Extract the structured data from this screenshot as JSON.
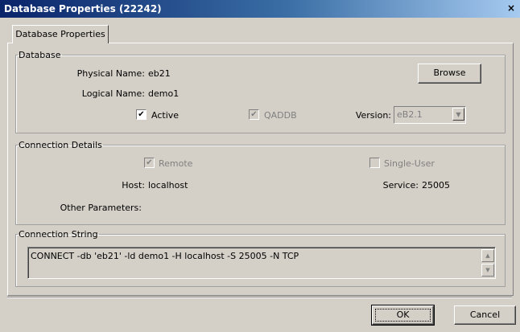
{
  "window": {
    "title": "Database Properties (22242)",
    "close_glyph": "×"
  },
  "tab": {
    "label": "Database Properties"
  },
  "database": {
    "legend": "Database",
    "physical_name_label": "Physical Name:",
    "physical_name_value": "eb21",
    "logical_name_label": "Logical Name:",
    "logical_name_value": "demo1",
    "browse_label": "Browse",
    "active_label": "Active",
    "active_checked": true,
    "qaddb_label": "QADDB",
    "qaddb_checked": true,
    "version_label": "Version:",
    "version_value": "eB2.1"
  },
  "connection": {
    "legend": "Connection Details",
    "remote_label": "Remote",
    "remote_checked": true,
    "single_user_label": "Single-User",
    "single_user_checked": false,
    "host_label": "Host:",
    "host_value": "localhost",
    "service_label": "Service:",
    "service_value": "25005",
    "other_params_label": "Other Parameters:"
  },
  "connection_string": {
    "legend": "Connection String",
    "value": "CONNECT -db 'eb21' -ld demo1 -H localhost -S 25005 -N TCP"
  },
  "buttons": {
    "ok_label": "OK",
    "cancel_label": "Cancel"
  },
  "icons": {
    "check_glyph": "✔",
    "scroll_up_glyph": "▲",
    "scroll_down_glyph": "▼",
    "combo_arrow_glyph": "▼"
  }
}
